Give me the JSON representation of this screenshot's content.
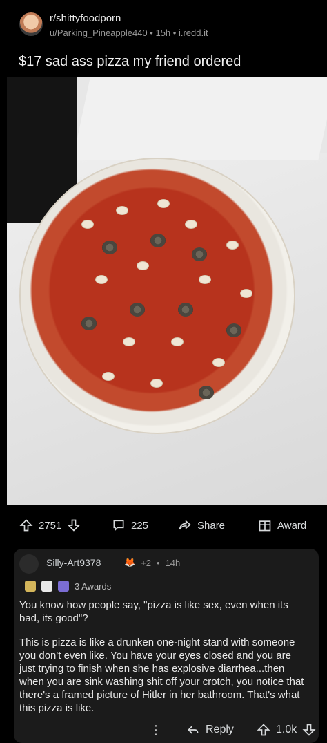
{
  "post": {
    "subreddit": "r/shittyfoodporn",
    "meta_user": "u/Parking_Pineapple440",
    "meta_age": "15h",
    "meta_domain": "i.redd.it",
    "title": "$17 sad ass pizza my friend ordered"
  },
  "actions": {
    "upvotes": "2751",
    "comments": "225",
    "share_label": "Share",
    "award_label": "Award"
  },
  "comment": {
    "username": "Silly-Art9378",
    "flair_count": "+2",
    "age": "14h",
    "awards_label": "3 Awards",
    "paragraph1": "You know how people say, \"pizza is like sex, even when its bad, its good\"?",
    "paragraph2": "This is pizza is like a drunken one-night stand with someone you don't even like. You have your eyes closed and you are just trying to finish when she has explosive diarrhea...then when you are sink washing shit off your crotch, you notice that there's a framed picture of Hitler in her bathroom. That's what this pizza is like.",
    "more_label": "⋮",
    "reply_label": "Reply",
    "votes": "1.0k"
  },
  "colors": {
    "background": "#000000",
    "card": "#1b1b1b",
    "text": "#d7dadc",
    "muted": "#9a9a9a"
  },
  "icons": {
    "upvote": "arrow-up-icon",
    "downvote": "arrow-down-icon",
    "comment": "comment-bubble-icon",
    "share": "share-arrow-icon",
    "award": "award-box-icon",
    "reply": "reply-arrow-icon",
    "more": "more-vertical-icon"
  }
}
